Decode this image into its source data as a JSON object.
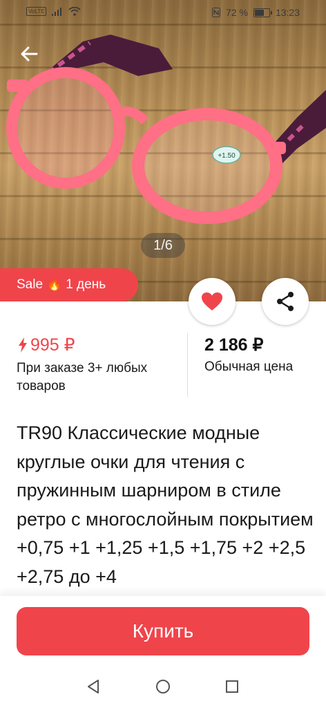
{
  "status_bar": {
    "left_badge": "VoLTE",
    "battery_text": "72 %",
    "battery_level": 0.72,
    "time": "13:23"
  },
  "gallery": {
    "counter": "1/6",
    "lens_label": "+1.50"
  },
  "sale_tag": {
    "label": "Sale",
    "duration": "1 день"
  },
  "price": {
    "sale_value": "995 ₽",
    "sale_condition": "При заказе 3+ любых товаров",
    "regular_value": "2 186 ₽",
    "regular_label": "Обычная цена"
  },
  "product": {
    "title": "TR90 Классические модные круглые очки для чтения с пружинным шарниром в стиле ретро с многослойным покрытием +0,75 +1 +1,25 +1,5 +1,75 +2 +2,5 +2,75 до +4"
  },
  "actions": {
    "buy_label": "Купить"
  },
  "colors": {
    "accent": "#f0444b"
  }
}
